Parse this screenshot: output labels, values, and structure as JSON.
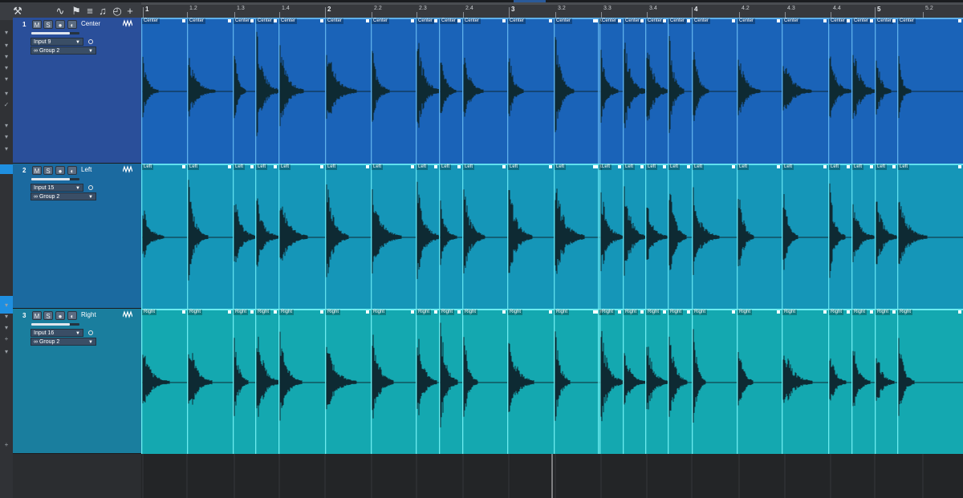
{
  "toolbar": {
    "items": [
      {
        "name": "wrench-icon",
        "glyph": "⚒"
      },
      {
        "name": "automation-icon",
        "glyph": "∿"
      },
      {
        "name": "marker-flag-icon",
        "glyph": "⚑"
      },
      {
        "name": "mixer-icon",
        "glyph": "≡"
      },
      {
        "name": "inspector-icon",
        "glyph": "♫"
      },
      {
        "name": "clock-icon",
        "glyph": "◴"
      },
      {
        "name": "add-track-icon",
        "glyph": "+"
      }
    ]
  },
  "ruler": {
    "labels": [
      {
        "text": "1",
        "major": true
      },
      {
        "text": "1.2"
      },
      {
        "text": "1.3"
      },
      {
        "text": "1.4"
      },
      {
        "text": "2",
        "major": true
      },
      {
        "text": "2.2"
      },
      {
        "text": "2.3"
      },
      {
        "text": "2.4"
      },
      {
        "text": "3",
        "major": true
      },
      {
        "text": "3.2"
      },
      {
        "text": "3.3"
      },
      {
        "text": "3.4"
      },
      {
        "text": "4",
        "major": true
      },
      {
        "text": "4.2"
      },
      {
        "text": "4.3"
      },
      {
        "text": "4.4"
      },
      {
        "text": "5",
        "major": true
      },
      {
        "text": "5.2"
      }
    ]
  },
  "tracks": [
    {
      "number": "1",
      "name": "Center",
      "mute_label": "M",
      "solo_label": "S",
      "input": "Input 9",
      "group": "Group 2",
      "volume": 0.8,
      "header_color": "#2a4f9a",
      "lane_color": "#1a63b8",
      "line_color": "#5fb0ea",
      "clip_label": "Center"
    },
    {
      "number": "2",
      "name": "Left",
      "mute_label": "M",
      "solo_label": "S",
      "input": "Input 15",
      "group": "Group 2",
      "volume": 0.8,
      "header_color": "#1b6aa0",
      "lane_color": "#1596b8",
      "line_color": "#60e0ee",
      "clip_label": "Left"
    },
    {
      "number": "3",
      "name": "Right",
      "mute_label": "M",
      "solo_label": "S",
      "input": "Input 16",
      "group": "Group 2",
      "volume": 0.8,
      "header_color": "#1a7e9e",
      "lane_color": "#14a8b0",
      "line_color": "#6cecef",
      "clip_label": "Right"
    }
  ],
  "colors": {
    "background": "#2b2d30",
    "selection_accent": "#1f8fe0",
    "waveform": "#0e2a33"
  }
}
